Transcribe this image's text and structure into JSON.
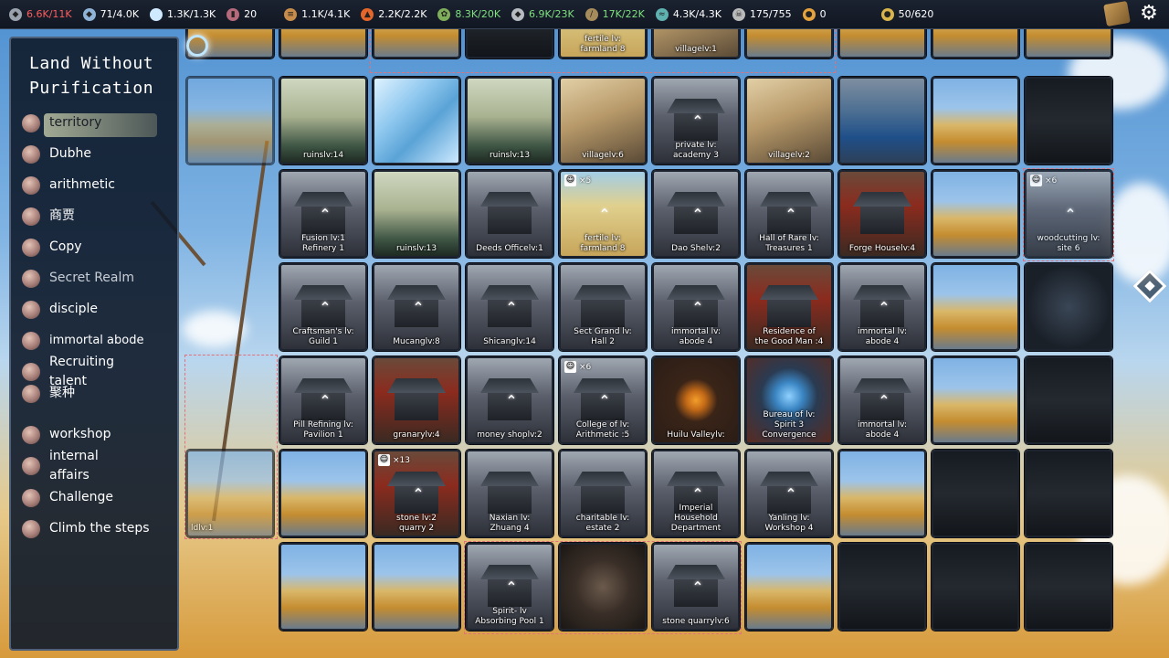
{
  "resources": [
    {
      "icon": "ore-icon",
      "value": "6.6K/11K",
      "color": "#ff5c5c"
    },
    {
      "icon": "water-drop-icon",
      "value": "71/4.0K",
      "color": "#ffffff"
    },
    {
      "icon": "spirit-orb-icon",
      "value": "1.3K/1.3K",
      "color": "#ffffff"
    },
    {
      "icon": "potion-icon",
      "value": "20",
      "color": "#ffffff"
    },
    {
      "icon": "wood-logs-icon",
      "value": "1.1K/4.1K",
      "color": "#ffffff"
    },
    {
      "icon": "fire-icon",
      "value": "2.2K/2.2K",
      "color": "#ffffff"
    },
    {
      "icon": "herb-icon",
      "value": "8.3K/20K",
      "color": "#7ee07e"
    },
    {
      "icon": "stone-icon",
      "value": "6.9K/23K",
      "color": "#7ee07e"
    },
    {
      "icon": "feather-icon",
      "value": "17K/22K",
      "color": "#7ee07e"
    },
    {
      "icon": "fish-icon",
      "value": "4.3K/4.3K",
      "color": "#ffffff"
    },
    {
      "icon": "skull-icon",
      "value": "175/755",
      "color": "#ffffff"
    },
    {
      "icon": "flame-drop-icon",
      "value": "0",
      "color": "#ffffff"
    },
    {
      "icon": "gold-coin-icon",
      "value": "50/620",
      "color": "#ffffff"
    }
  ],
  "sidebar": {
    "title_line1": "Land Without",
    "title_line2": "Purification",
    "items": [
      {
        "label": "territory"
      },
      {
        "label": "Dubhe"
      },
      {
        "label": "arithmetic"
      },
      {
        "label": "商贾"
      },
      {
        "label": "Copy"
      },
      {
        "label": "Secret Realm"
      },
      {
        "label": "disciple"
      },
      {
        "label": "immortal abode"
      },
      {
        "label": "Recruiting\ntalent"
      },
      {
        "label": "聚种"
      },
      {
        "label": "workshop"
      },
      {
        "label": "internal\naffairs"
      },
      {
        "label": "Challenge"
      },
      {
        "label": "Climb the steps"
      }
    ]
  },
  "tiles": {
    "r0": [
      "",
      "",
      "",
      "fertile     lv:\nfarmland    8",
      "villagelv:1",
      "",
      "",
      "",
      ""
    ],
    "r1": [
      "ruinslv:14",
      "",
      "ruinslv:13",
      "villagelv:6",
      "private    lv:\nacademy    3",
      "villagelv:2",
      "",
      "",
      ""
    ],
    "r2": [
      "Fusion     lv:1\nRefinery   1",
      "ruinslv:13",
      "Deeds Officelv:1",
      "fertile     lv:\nfarmland    8",
      "Dao Shelv:2",
      "Hall of Rare lv:\nTreasures    1",
      "Forge Houselv:4",
      "",
      "woodcutting lv:\nsite        6"
    ],
    "r3": [
      "Craftsman's lv:\nGuild       1",
      "Mucanglv:8",
      "Shicanglv:14",
      "Sect Grand  lv:\nHall        2",
      "immortal   lv:\nabode      4",
      "Residence of\nthe Good Man :4",
      "immortal   lv:\nabode      4",
      "",
      ""
    ],
    "r4": [
      "Pill Refining lv:\nPavilion     1",
      "granarylv:4",
      "money shoplv:2",
      "College of  lv:\nArithmetic  :5",
      "Huilu Valleylv:",
      "Bureau of   lv:\nSpirit      3\nConvergence",
      "immortal   lv:\nabode      4",
      "",
      ""
    ],
    "r5": [
      "",
      "stone      lv:2\nquarry     2",
      "Naxian     lv:\nZhuang     4",
      "charitable  lv:\nestate      2",
      "Imperial\nHousehold\nDepartment",
      "Yanling    lv:\nWorkshop    4",
      "",
      "",
      ""
    ],
    "r6": [
      "",
      "",
      "Spirit-    lv\nAbsorbing Pool 1",
      "",
      "stone quarrylv:6",
      "",
      "",
      "",
      ""
    ],
    "left_partial": "ldlv:1",
    "badges": {
      "a": "×5",
      "b": "×6",
      "c": "×6",
      "d": "×13"
    }
  }
}
